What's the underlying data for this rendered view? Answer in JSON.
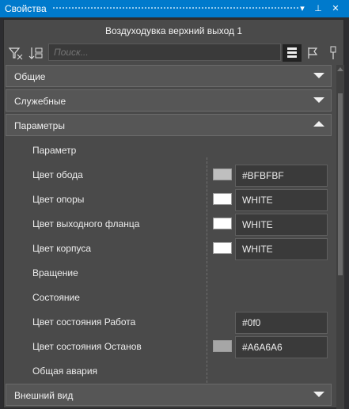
{
  "window": {
    "title": "Свойства"
  },
  "object": {
    "title": "Воздуходувка верхний выход 1"
  },
  "search": {
    "placeholder": "Поиск..."
  },
  "sections": {
    "general": "Общие",
    "service": "Служебные",
    "params": "Параметры",
    "appearance": "Внешний вид"
  },
  "rows": [
    {
      "name": "Параметр"
    },
    {
      "name": "Цвет обода",
      "value": "#BFBFBF",
      "swatch": "#bfbfbf"
    },
    {
      "name": "Цвет опоры",
      "value": "WHITE",
      "swatch": "#ffffff"
    },
    {
      "name": "Цвет выходного фланца",
      "value": "WHITE",
      "swatch": "#ffffff"
    },
    {
      "name": "Цвет корпуса",
      "value": "WHITE",
      "swatch": "#ffffff"
    },
    {
      "name": "Вращение"
    },
    {
      "name": "Состояние"
    },
    {
      "name": "Цвет состояния Работа",
      "value": "#0f0"
    },
    {
      "name": "Цвет состояния Останов",
      "value": "#A6A6A6",
      "swatch": "#a6a6a6"
    },
    {
      "name": "Общая авария"
    }
  ],
  "colors": {
    "titlebar": "#007acc",
    "panel": "#4a4a4a"
  }
}
